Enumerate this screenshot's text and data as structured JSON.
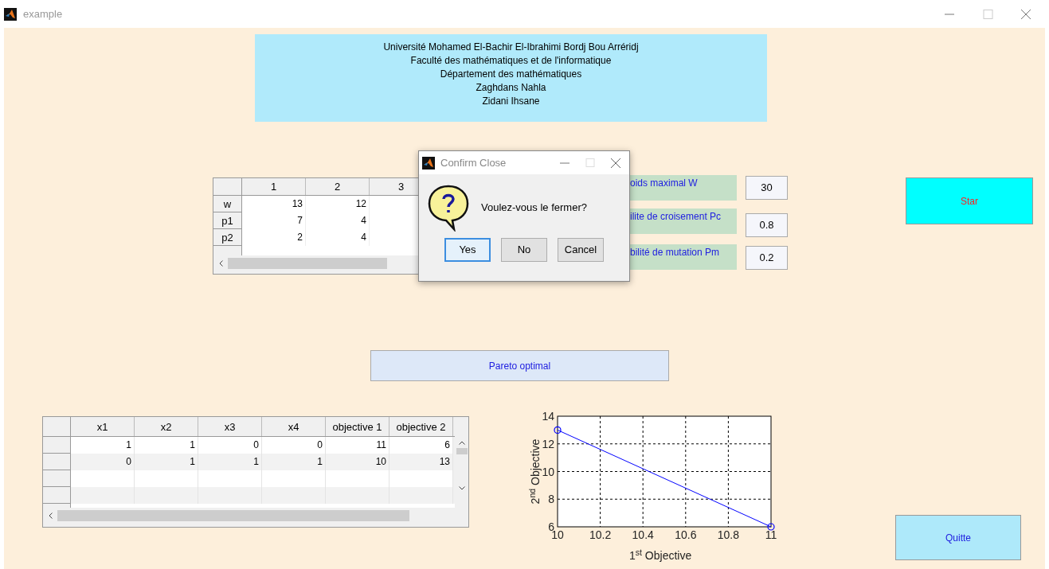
{
  "window": {
    "title": "example"
  },
  "header": {
    "lines": [
      "Université Mohamed El-Bachir El-Ibrahimi Bordj Bou Arréridj",
      "Faculté des mathématiques et de l'informatique",
      "Département des mathématiques",
      "Zaghdans Nahla",
      "Zidani Ihsane"
    ]
  },
  "data_table": {
    "columns": [
      "1",
      "2",
      "3"
    ],
    "rows": [
      {
        "header": "w",
        "cells": [
          "13",
          "12"
        ]
      },
      {
        "header": "p1",
        "cells": [
          "7",
          "4"
        ]
      },
      {
        "header": "p2",
        "cells": [
          "2",
          "4"
        ]
      }
    ]
  },
  "parameters": [
    {
      "label": "oids maximal W",
      "value": "30"
    },
    {
      "label": "ilite de croisement Pc",
      "value": "0.8"
    },
    {
      "label": "bilité de mutation Pm",
      "value": "0.2"
    }
  ],
  "start_button": "Star",
  "pareto_button": "Pareto optimal",
  "results_table": {
    "columns": [
      "x1",
      "x2",
      "x3",
      "x4",
      "objective 1",
      "objective 2"
    ],
    "rows": [
      [
        "1",
        "1",
        "0",
        "0",
        "11",
        "6"
      ],
      [
        "0",
        "1",
        "1",
        "1",
        "10",
        "13"
      ]
    ]
  },
  "chart": {
    "chart_data": {
      "type": "line",
      "xlabel": "1$^{st}$ Objective",
      "ylabel": "2$^{nd}$ Objective",
      "x": [
        10,
        11
      ],
      "grid": true,
      "series": [
        {
          "color": "#0000ff",
          "marker": "o",
          "values": [
            13,
            6
          ]
        }
      ],
      "xlim": [
        10,
        11
      ],
      "ylim": [
        6,
        14
      ],
      "xticks": [
        10,
        10.2,
        10.4,
        10.6,
        10.8,
        11
      ],
      "yticks": [
        6,
        8,
        10,
        12,
        14
      ]
    }
  },
  "quit_button": "Quitte",
  "dialog": {
    "title": "Confirm Close",
    "message": "Voulez-vous le fermer?",
    "buttons": [
      {
        "label": "Yes",
        "focused": true
      },
      {
        "label": "No",
        "focused": false
      },
      {
        "label": "Cancel",
        "focused": false
      }
    ]
  }
}
